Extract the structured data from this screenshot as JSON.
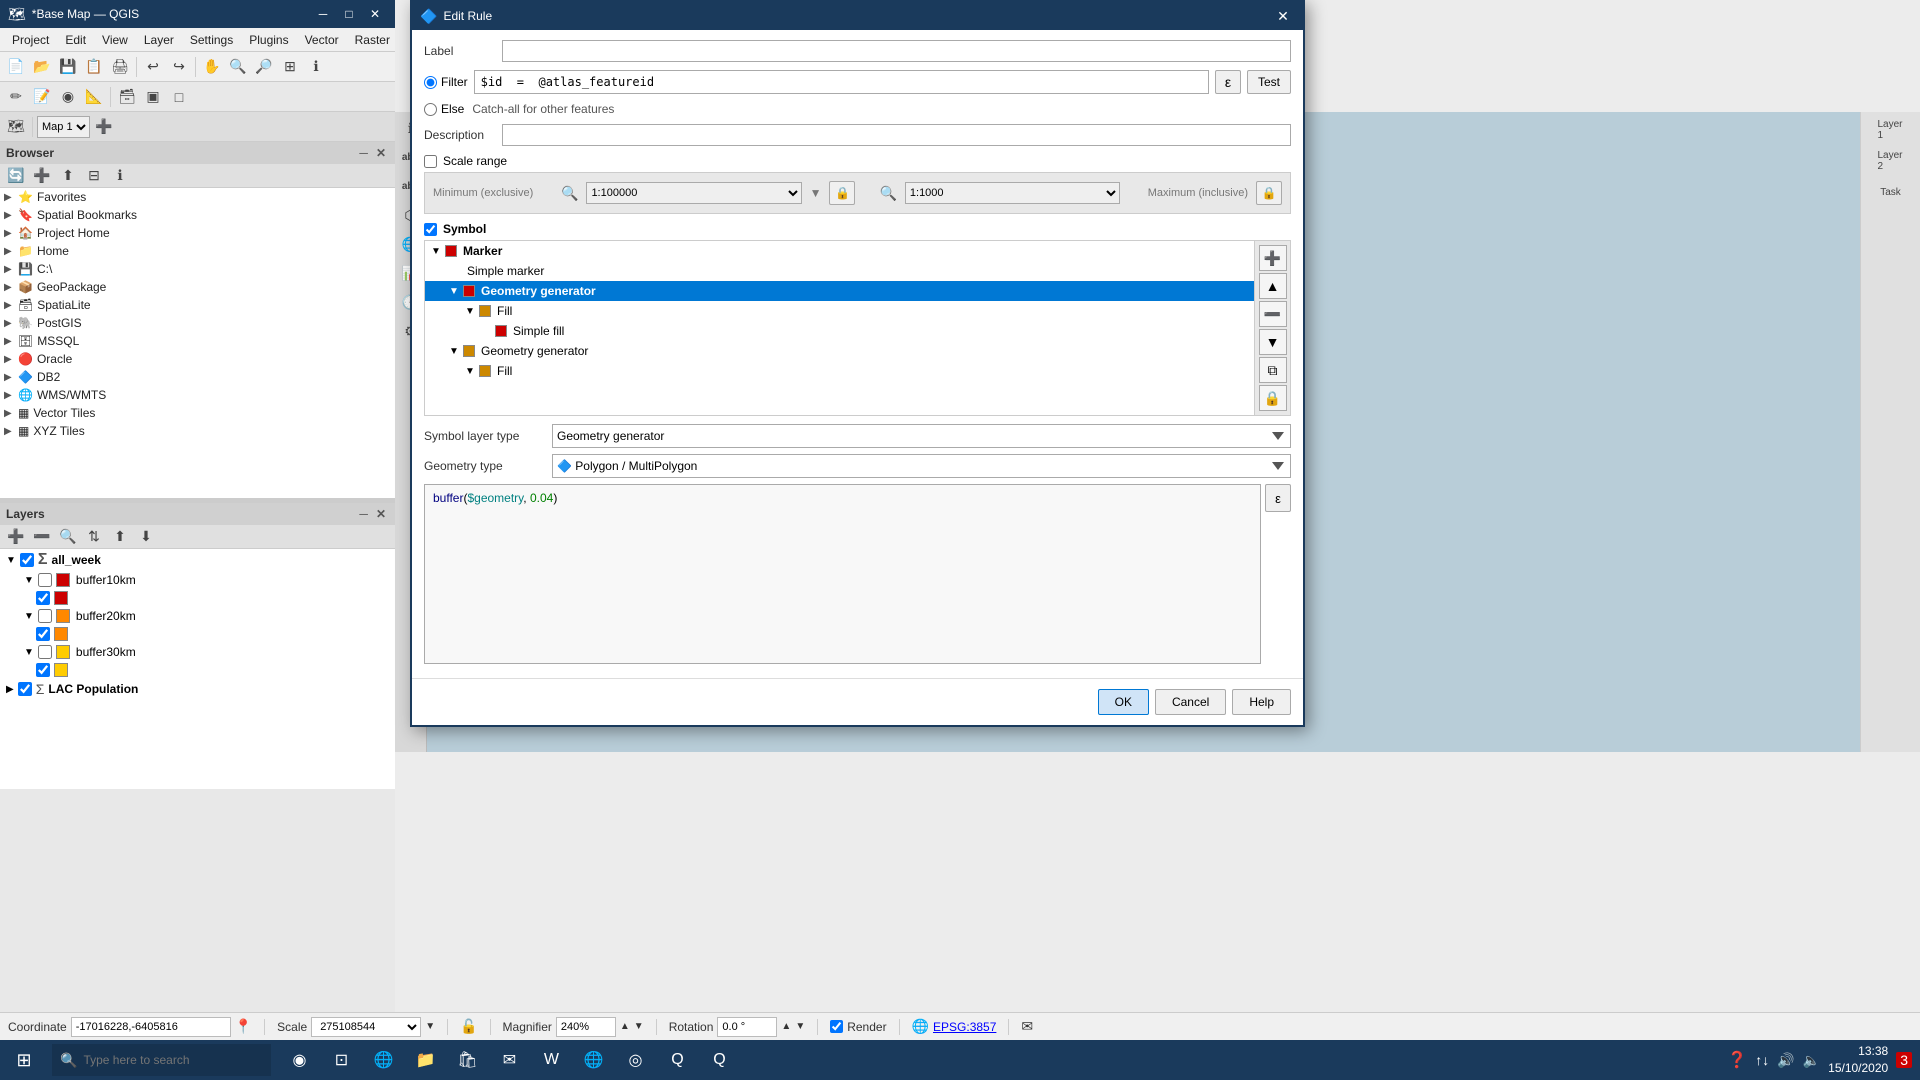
{
  "app": {
    "title": "*Base Map — QGIS",
    "icon": "🗺"
  },
  "menubar": {
    "items": [
      "Project",
      "Edit",
      "View",
      "Layer",
      "Settings",
      "Plugins",
      "Vector",
      "Raster"
    ]
  },
  "browser": {
    "title": "Browser",
    "items": [
      {
        "label": "Favorites",
        "icon": "⭐",
        "indent": 0,
        "arrow": "▶"
      },
      {
        "label": "Spatial Bookmarks",
        "icon": "🔖",
        "indent": 0,
        "arrow": "▶"
      },
      {
        "label": "Project Home",
        "icon": "🏠",
        "indent": 0,
        "arrow": "▶"
      },
      {
        "label": "Home",
        "icon": "📁",
        "indent": 0,
        "arrow": "▶"
      },
      {
        "label": "C:\\",
        "icon": "💾",
        "indent": 0,
        "arrow": "▶"
      },
      {
        "label": "GeoPackage",
        "icon": "📦",
        "indent": 0,
        "arrow": "▶"
      },
      {
        "label": "SpatiaLite",
        "icon": "🗃",
        "indent": 0,
        "arrow": "▶"
      },
      {
        "label": "PostGIS",
        "icon": "🐘",
        "indent": 0,
        "arrow": "▶"
      },
      {
        "label": "MSSQL",
        "icon": "🗄",
        "indent": 0,
        "arrow": "▶"
      },
      {
        "label": "Oracle",
        "icon": "🔴",
        "indent": 0,
        "arrow": "▶"
      },
      {
        "label": "DB2",
        "icon": "🔷",
        "indent": 0,
        "arrow": "▶"
      },
      {
        "label": "WMS/WMTS",
        "icon": "🌐",
        "indent": 0,
        "arrow": "▶"
      },
      {
        "label": "Vector Tiles",
        "icon": "▦",
        "indent": 0,
        "arrow": "▶"
      },
      {
        "label": "XYZ Tiles",
        "icon": "▦",
        "indent": 0,
        "arrow": "▶"
      }
    ]
  },
  "layers": {
    "title": "Layers",
    "items": [
      {
        "label": "all_week",
        "indent": 0,
        "bold": true,
        "checked": true,
        "color": null,
        "arrow": "▼"
      },
      {
        "label": "buffer10km",
        "indent": 1,
        "bold": false,
        "checked": false,
        "color": "#cc0000",
        "arrow": "▼"
      },
      {
        "label": "buffer20km",
        "indent": 1,
        "bold": false,
        "checked": false,
        "color": "#ff8800",
        "arrow": "▼"
      },
      {
        "label": "buffer30km",
        "indent": 1,
        "bold": false,
        "checked": false,
        "color": "#ffcc00",
        "arrow": "▼"
      },
      {
        "label": "LAC Population",
        "indent": 0,
        "bold": true,
        "checked": true,
        "color": null,
        "arrow": "▶"
      }
    ]
  },
  "dialog": {
    "title": "Edit Rule",
    "label_field": "",
    "filter_value": "$id  =  @atlas_featureid",
    "else_label": "Catch-all for other features",
    "description": "",
    "scale_range_checked": false,
    "min_scale": "1:100000",
    "max_scale": "1:1000",
    "symbol_checked": true,
    "symbol_label": "Symbol",
    "symbol_layer_type": "Geometry generator",
    "geometry_type": "Polygon / MultiPolygon",
    "code": "buffer($geometry, 0.04)",
    "tree_items": [
      {
        "label": "Marker",
        "indent": 0,
        "arrow": "▼",
        "color": "#cc0000",
        "bold": true,
        "selected": false
      },
      {
        "label": "Simple marker",
        "indent": 1,
        "arrow": "",
        "color": null,
        "bold": false,
        "selected": false
      },
      {
        "label": "Geometry generator",
        "indent": 1,
        "arrow": "▼",
        "color": "#cc0000",
        "bold": true,
        "selected": true
      },
      {
        "label": "Fill",
        "indent": 2,
        "arrow": "▼",
        "color": "#cc8800",
        "bold": false,
        "selected": false
      },
      {
        "label": "Simple fill",
        "indent": 3,
        "arrow": "",
        "color": "#cc0000",
        "bold": false,
        "selected": false
      },
      {
        "label": "Geometry generator",
        "indent": 1,
        "arrow": "▼",
        "color": "#cc8800",
        "bold": false,
        "selected": false
      },
      {
        "label": "Fill",
        "indent": 2,
        "arrow": "▼",
        "color": "#cc8800",
        "bold": false,
        "selected": false
      }
    ],
    "buttons": {
      "ok": "OK",
      "cancel": "Cancel",
      "help": "Help",
      "test": "Test",
      "epsilon": "ε"
    }
  },
  "statusbar": {
    "coordinate_label": "Coordinate",
    "coordinate_value": "-17016228,-6405816",
    "scale_label": "Scale",
    "scale_value": "275108544",
    "magnifier_label": "Magnifier",
    "magnifier_value": "240%",
    "rotation_label": "Rotation",
    "rotation_value": "0.0 °",
    "render_label": "Render",
    "crs_label": "EPSG:3857"
  },
  "taskbar": {
    "time": "13:38",
    "date": "15/10/2020",
    "search_placeholder": "Type here to search"
  }
}
